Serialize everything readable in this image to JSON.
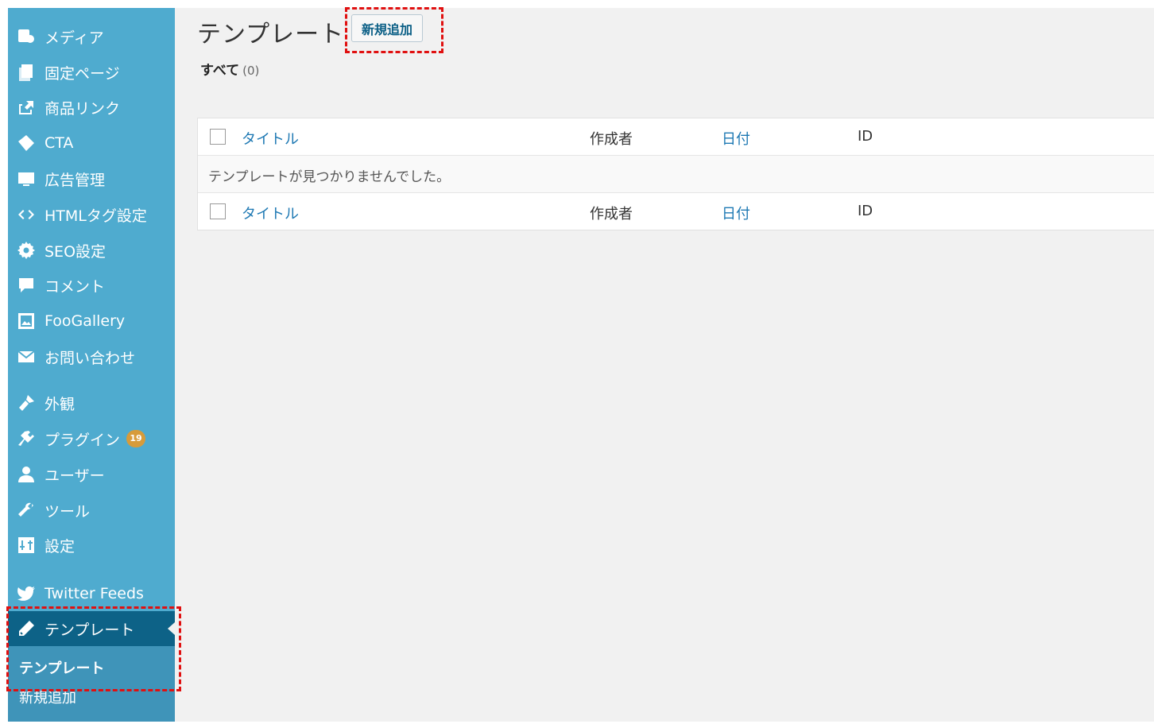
{
  "sidebar": {
    "items": [
      {
        "label": "メディア",
        "icon": "media-icon"
      },
      {
        "label": "固定ページ",
        "icon": "pages-icon"
      },
      {
        "label": "商品リンク",
        "icon": "share-icon"
      },
      {
        "label": "CTA",
        "icon": "tag-icon"
      },
      {
        "label": "広告管理",
        "icon": "ad-icon"
      },
      {
        "label": "HTMLタグ設定",
        "icon": "code-icon"
      },
      {
        "label": "SEO設定",
        "icon": "gear-icon"
      },
      {
        "label": "コメント",
        "icon": "comment-icon"
      },
      {
        "label": "FooGallery",
        "icon": "gallery-icon"
      },
      {
        "label": "お問い合わせ",
        "icon": "mail-icon"
      },
      {
        "label": "外観",
        "icon": "brush-icon"
      },
      {
        "label": "プラグイン",
        "icon": "plugin-icon",
        "badge": "19"
      },
      {
        "label": "ユーザー",
        "icon": "user-icon"
      },
      {
        "label": "ツール",
        "icon": "wrench-icon"
      },
      {
        "label": "設定",
        "icon": "settings-icon"
      },
      {
        "label": "Twitter Feeds",
        "icon": "twitter-icon"
      },
      {
        "label": "テンプレート",
        "icon": "pencil-icon",
        "active": true
      }
    ],
    "submenu": [
      {
        "label": "テンプレート",
        "current": true
      },
      {
        "label": "新規追加"
      }
    ]
  },
  "page": {
    "title": "テンプレート",
    "add_new": "新規追加",
    "filter_label": "すべて",
    "filter_count": "(0)"
  },
  "table": {
    "columns": [
      "タイトル",
      "作成者",
      "日付",
      "ID"
    ],
    "empty_message": "テンプレートが見つかりませんでした。"
  },
  "colors": {
    "sidebar_bg": "#4fabcf",
    "sidebar_active": "#0d6287",
    "link": "#1d78b3",
    "highlight": "#e01010",
    "badge": "#d79b3a"
  }
}
